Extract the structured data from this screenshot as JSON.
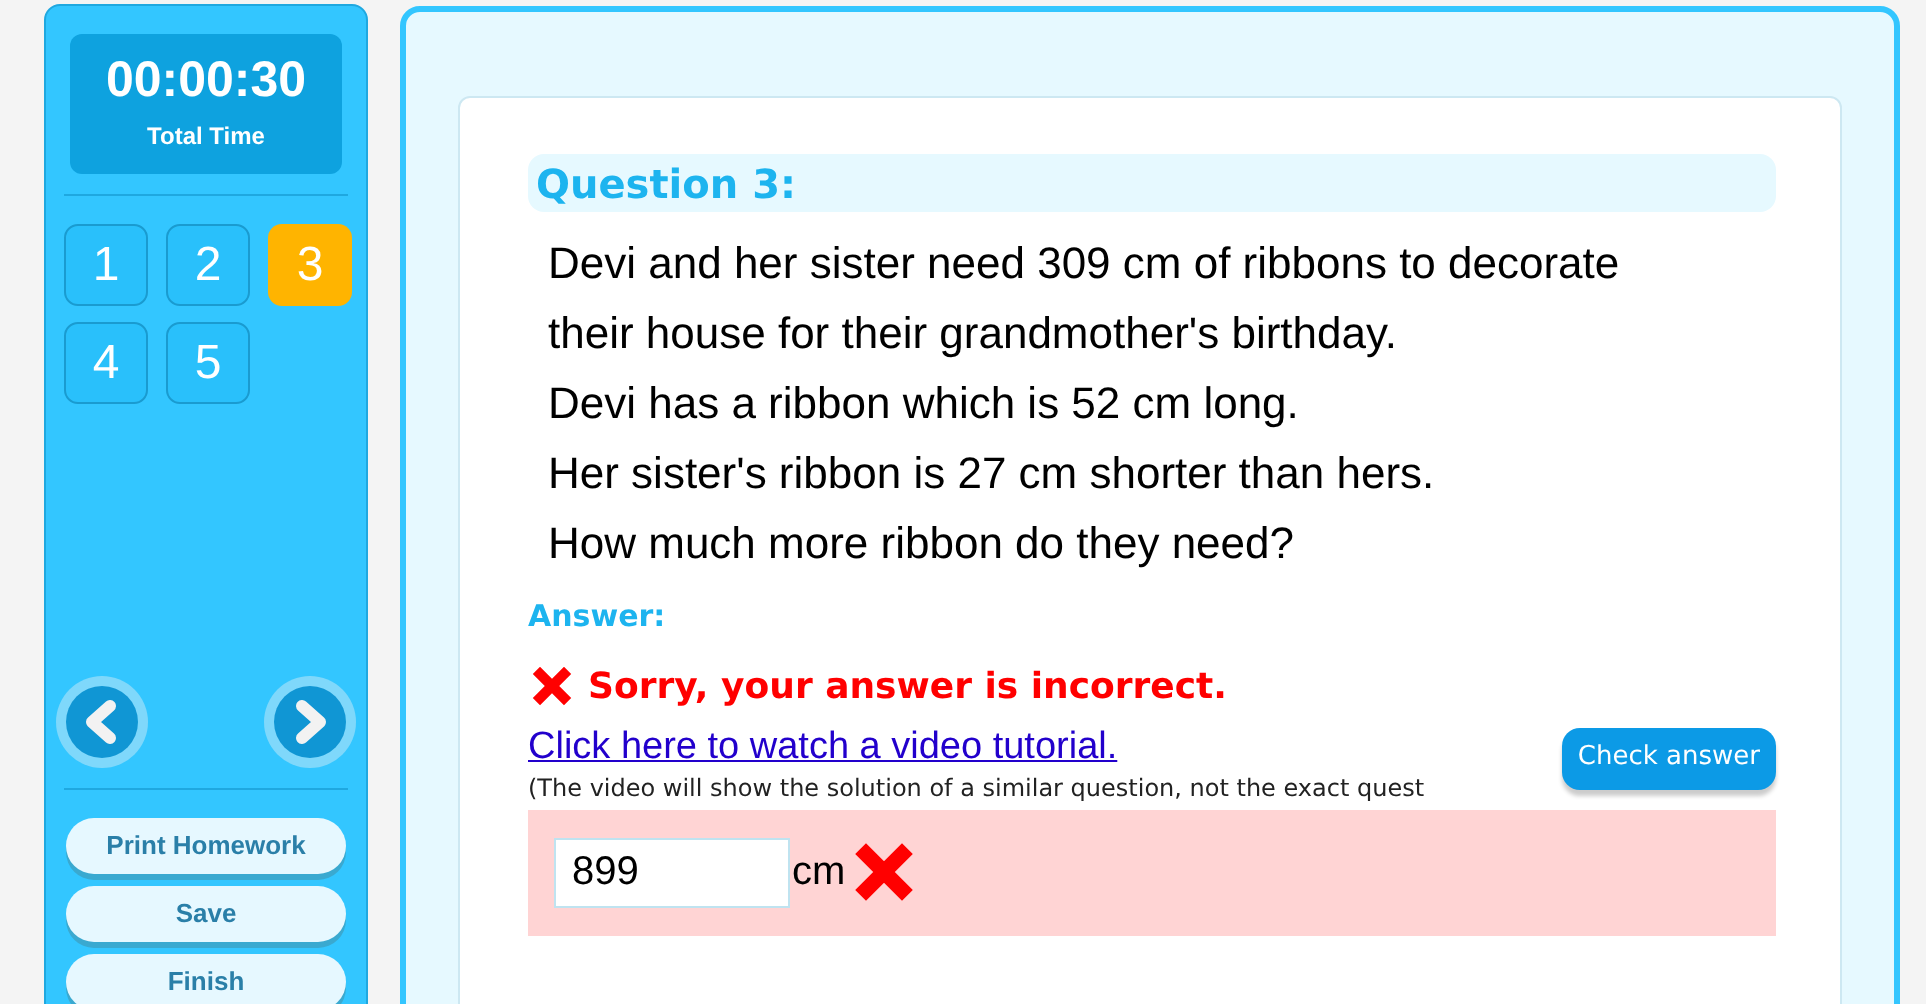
{
  "timer": {
    "time": "00:00:30",
    "label": "Total Time"
  },
  "questions": [
    {
      "label": "1",
      "selected": false
    },
    {
      "label": "2",
      "selected": false
    },
    {
      "label": "3",
      "selected": true
    },
    {
      "label": "4",
      "selected": false
    },
    {
      "label": "5",
      "selected": false
    }
  ],
  "sidebar_buttons": [
    "Print Homework",
    "Save",
    "Finish"
  ],
  "question": {
    "title": "Question 3:",
    "lines": [
      "Devi and her sister need 309 cm of ribbons to decorate",
      "their house for their grandmother's birthday.",
      "Devi has a ribbon which is 52 cm long.",
      "Her sister's ribbon is 27 cm shorter than hers.",
      "How much more ribbon do they need?"
    ]
  },
  "answer": {
    "label": "Answer:",
    "feedback": "Sorry, your answer is incorrect.",
    "correct": false,
    "video_link": "Click here to watch a video tutorial.",
    "video_note": "(The video will show the solution of a similar question, not the exact quest",
    "check_button": "Check answer",
    "value": "899",
    "unit": "cm"
  }
}
